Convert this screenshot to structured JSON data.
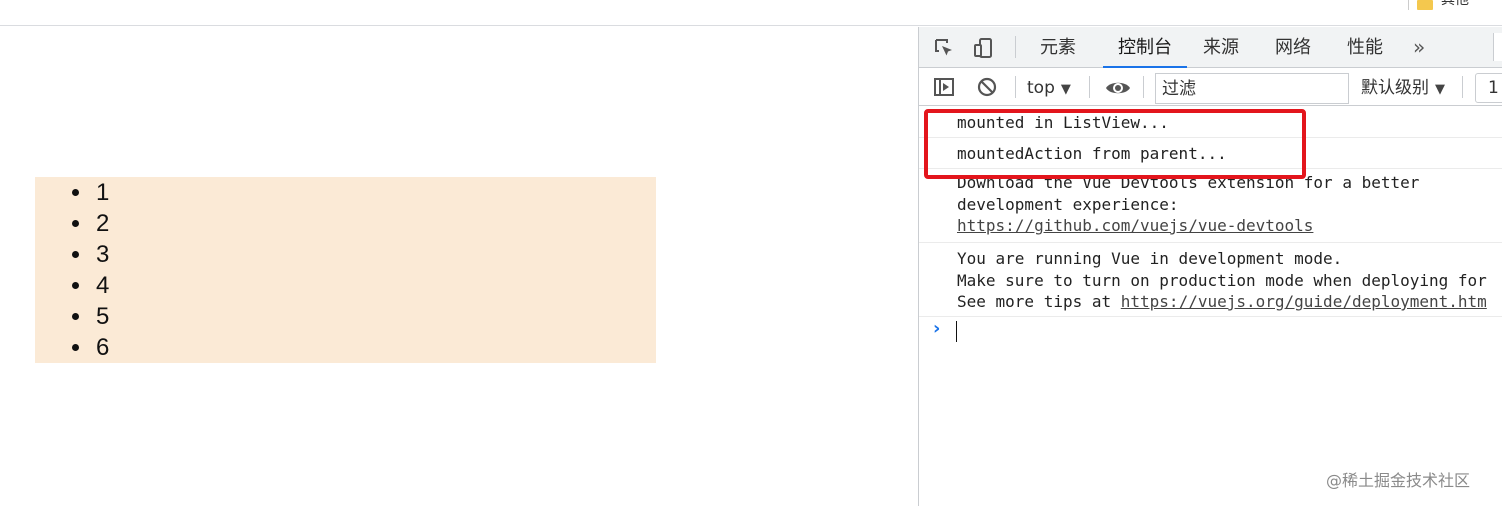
{
  "bookmarks": {
    "folder_label": "其他"
  },
  "page": {
    "list_items": [
      "1",
      "2",
      "3",
      "4",
      "5",
      "6"
    ]
  },
  "devtools": {
    "tabs": [
      {
        "label": "元素",
        "active": false
      },
      {
        "label": "控制台",
        "active": true
      },
      {
        "label": "来源",
        "active": false
      },
      {
        "label": "网络",
        "active": false
      },
      {
        "label": "性能",
        "active": false
      }
    ],
    "more_tabs": "»",
    "toolbar": {
      "context": "top",
      "filter_placeholder": "过滤",
      "level": "默认级别",
      "issues_count": "1"
    },
    "console_messages": [
      {
        "lines": [
          "mounted in ListView..."
        ]
      },
      {
        "lines": [
          "mountedAction from parent..."
        ]
      },
      {
        "lines": [
          "Download the Vue Devtools extension for a better",
          "development experience:"
        ],
        "link": "https://github.com/vuejs/vue-devtools"
      },
      {
        "lines": [
          "You are running Vue in development mode.",
          "Make sure to turn on production mode when deploying for"
        ],
        "last_prefix": "See more tips at ",
        "link": "https://vuejs.org/guide/deployment.htm"
      }
    ],
    "prompt_symbol": "›"
  },
  "watermark": "@稀土掘金技术社区",
  "colors": {
    "list_bg": "#fbead6",
    "highlight": "#e3151c",
    "accent": "#1a73e8"
  }
}
